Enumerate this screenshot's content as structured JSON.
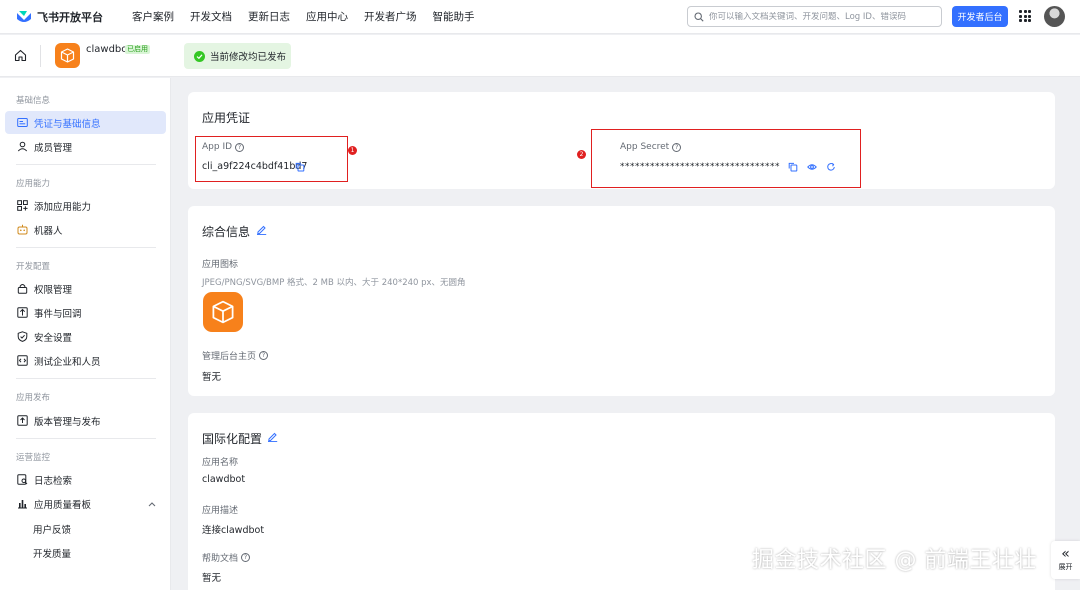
{
  "topnav": {
    "logo_text": "飞书开放平台",
    "links": [
      "客户案例",
      "开发文档",
      "更新日志",
      "应用中心",
      "开发者广场",
      "智能助手"
    ],
    "search_placeholder": "你可以输入文档关键词、开发问题、Log ID、错误码",
    "console_label": "开发者后台"
  },
  "app": {
    "name": "clawdbot",
    "status": "已启用",
    "publish_notice": "当前修改均已发布"
  },
  "sidebar": {
    "sections": [
      {
        "title": "基础信息",
        "items": [
          "凭证与基础信息",
          "成员管理"
        ]
      },
      {
        "title": "应用能力",
        "items": [
          "添加应用能力",
          "机器人"
        ]
      },
      {
        "title": "开发配置",
        "items": [
          "权限管理",
          "事件与回调",
          "安全设置",
          "测试企业和人员"
        ]
      },
      {
        "title": "应用发布",
        "items": [
          "版本管理与发布"
        ]
      },
      {
        "title": "运营监控",
        "items": [
          "日志检索",
          "应用质量看板"
        ]
      }
    ],
    "sub_items": [
      "用户反馈",
      "开发质量"
    ],
    "active": "凭证与基础信息"
  },
  "credentials": {
    "title": "应用凭证",
    "app_id_label": "App ID",
    "app_id_value": "cli_a9f224c4bdf41bd7",
    "app_secret_label": "App Secret",
    "app_secret_value": "********************************",
    "badge_1": "1",
    "badge_2": "2"
  },
  "general": {
    "title": "综合信息",
    "icon_label": "应用图标",
    "icon_hint": "JPEG/PNG/SVG/BMP 格式、2 MB 以内、大于 240*240 px、无圆角",
    "homepage_label": "管理后台主页",
    "homepage_value": "暂无"
  },
  "i18n": {
    "title": "国际化配置",
    "name_label": "应用名称",
    "name_value": "clawdbot",
    "desc_label": "应用描述",
    "desc_value": "连接clawdbot",
    "help_label": "帮助文档",
    "help_value": "暂无"
  },
  "watermark": "掘金技术社区 @ 前端王壮壮",
  "expand": {
    "arrow": "«",
    "label": "展开"
  },
  "colors": {
    "primary": "#3370ff",
    "app_icon": "#f7811b",
    "highlight": "#e02020",
    "success": "#34c724"
  }
}
